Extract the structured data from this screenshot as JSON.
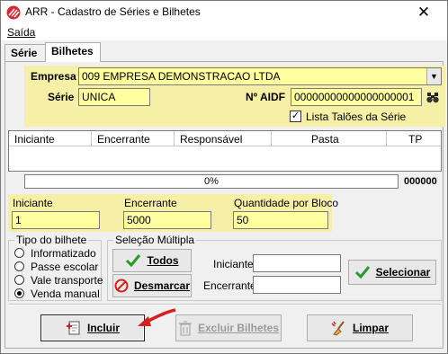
{
  "window": {
    "title": "ARR - Cadastro de Séries e Bilhetes",
    "close_glyph": "✕"
  },
  "menu": {
    "saida": "Saída"
  },
  "tabs": [
    {
      "label": "Série"
    },
    {
      "label": "Bilhetes"
    }
  ],
  "header": {
    "empresa_label": "Empresa",
    "empresa_value": "009 EMPRESA DEMONSTRACAO LTDA",
    "serie_label": "Série",
    "serie_value": "UNICA",
    "aidf_label": "Nº AIDF",
    "aidf_value": "00000000000000000001",
    "lista_taloes_label": "Lista Talões da Série",
    "lista_taloes_checked": true
  },
  "grid": {
    "columns": [
      "Iniciante",
      "Encerrante",
      "Responsável",
      "Pasta",
      "TP"
    ],
    "rows": []
  },
  "progress": {
    "text": "0%",
    "value": 0,
    "count": "000000"
  },
  "range": {
    "iniciante_label": "Iniciante",
    "iniciante_value": "1",
    "encerrante_label": "Encerrante",
    "encerrante_value": "5000",
    "qtd_label": "Quantidade por Bloco",
    "qtd_value": "50"
  },
  "tipo_bilhete": {
    "title": "Tipo do bilhete",
    "options": [
      "Informatizado",
      "Passe escolar",
      "Vale transporte",
      "Venda manual"
    ],
    "selected": "Venda manual"
  },
  "selecao_multipla": {
    "title": "Seleção Múltipla",
    "todos_label": "Todos",
    "desmarcar_label": "Desmarcar",
    "iniciante_label": "Iniciante",
    "encerrante_label": "Encerrante",
    "iniciante_value": "",
    "encerrante_value": "",
    "selecionar_label": "Selecionar"
  },
  "actions": {
    "incluir_label": "Incluir",
    "excluir_label": "Excluir Bilhetes",
    "limpar_label": "Limpar"
  },
  "colors": {
    "highlight_yellow": "#f6f0a6",
    "field_yellow": "#ffffa0",
    "arrow_red": "#d81e1e"
  }
}
